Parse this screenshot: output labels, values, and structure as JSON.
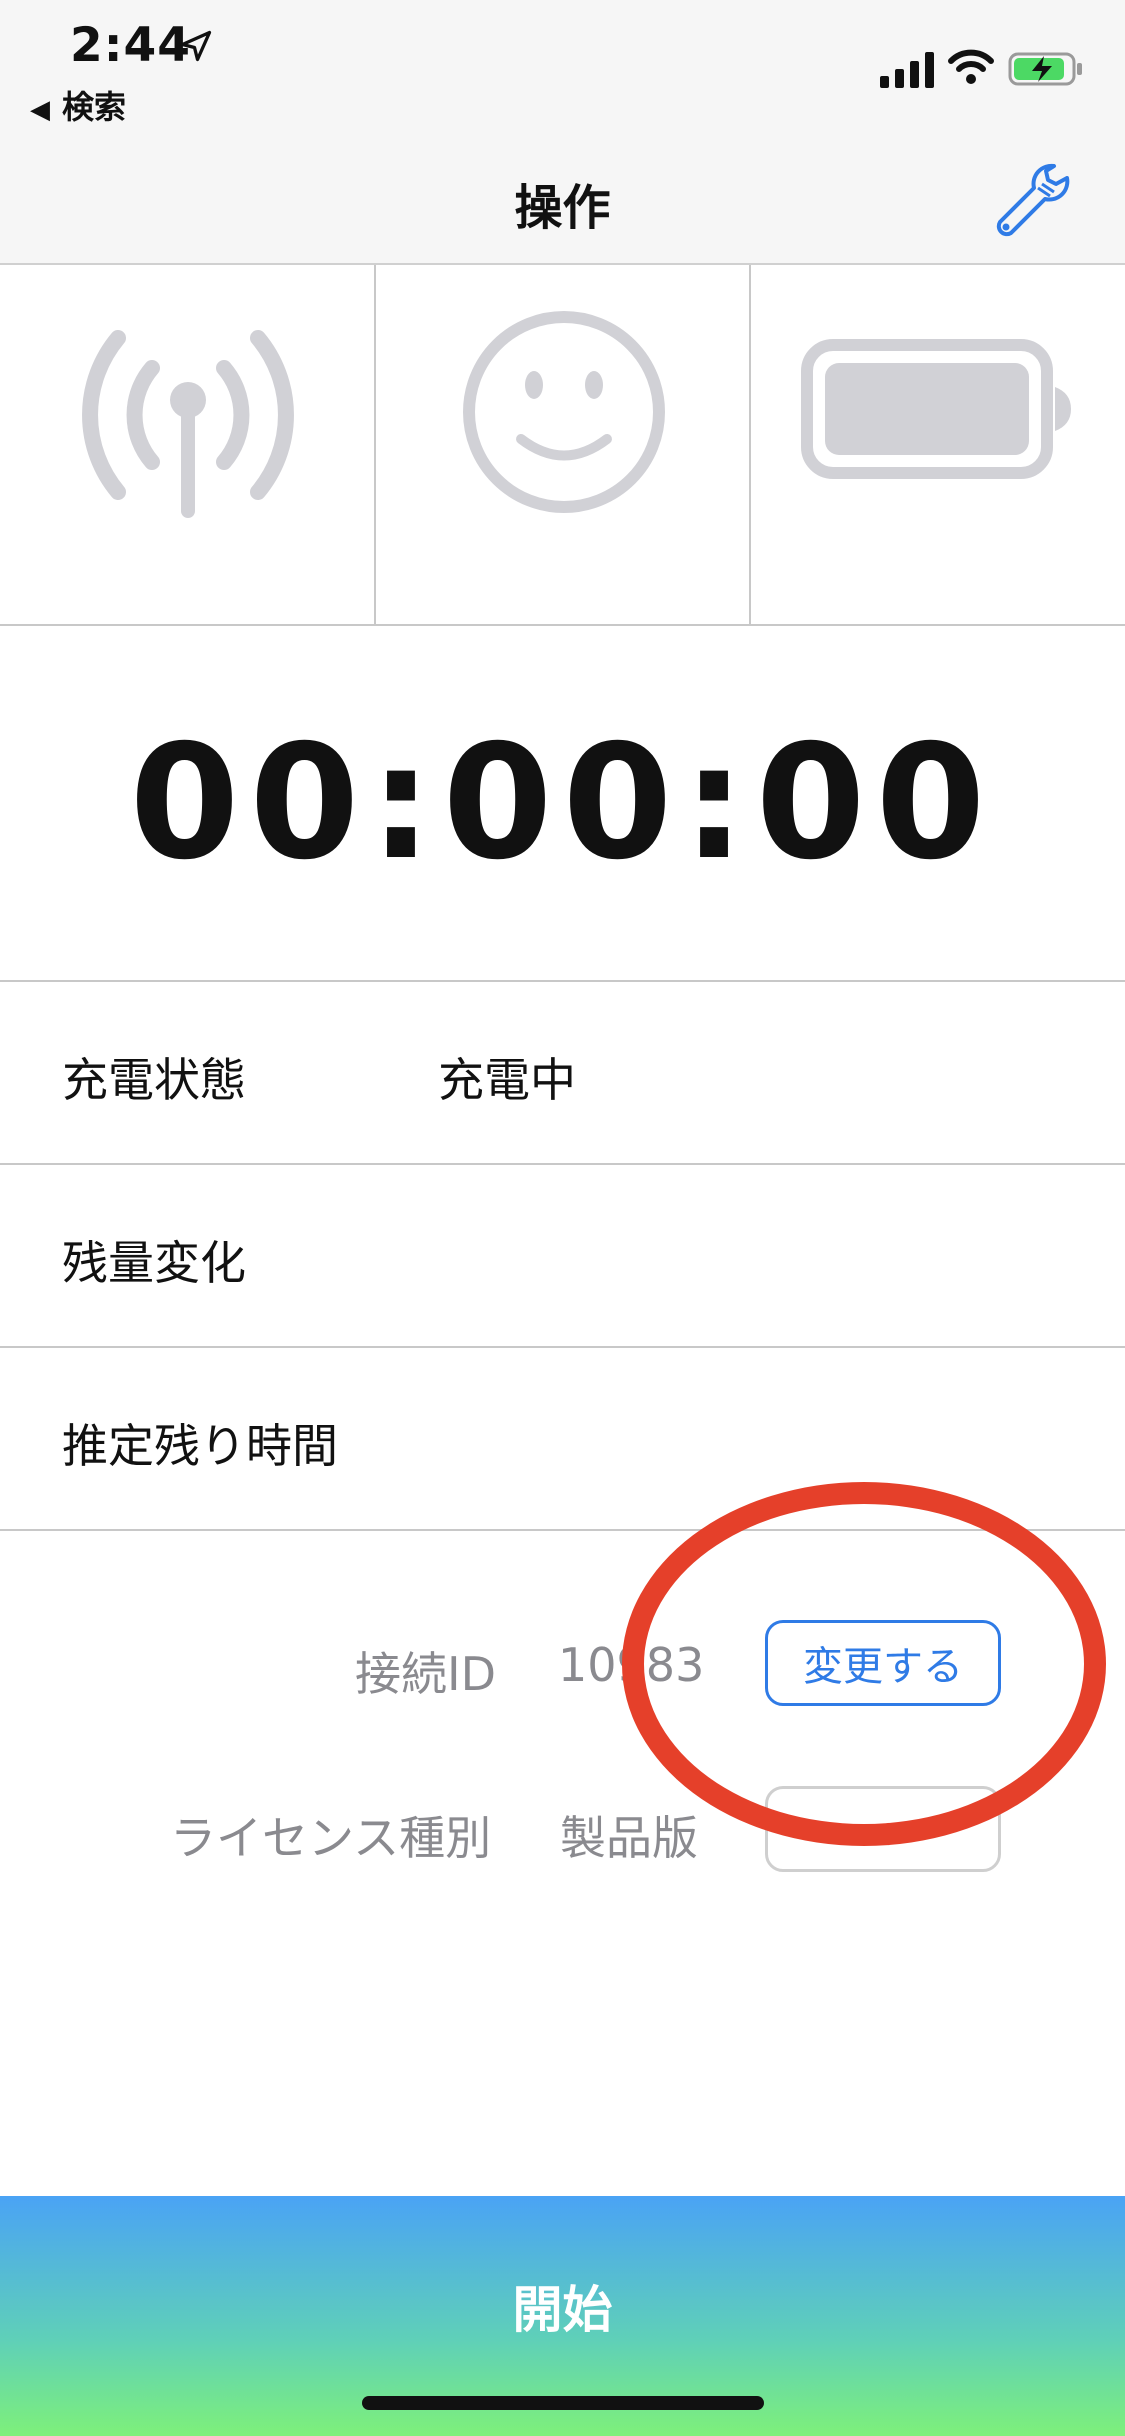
{
  "status_bar": {
    "time": "2:44",
    "back_label": "検索",
    "battery_color": "#4cd964"
  },
  "nav": {
    "title": "操作"
  },
  "indicators": [
    {
      "icon": "antenna-icon"
    },
    {
      "icon": "smiley-icon"
    },
    {
      "icon": "battery-icon"
    }
  ],
  "timer": {
    "display": "00:00:00"
  },
  "rows": [
    {
      "label": "充電状態",
      "value": "充電中"
    },
    {
      "label": "残量変化",
      "value": ""
    },
    {
      "label": "推定残り時間",
      "value": ""
    }
  ],
  "info": {
    "connection_id_label": "接続ID",
    "connection_id_value": "10983",
    "change_button": "変更する",
    "license_label": "ライセンス種別",
    "license_value": "製品版"
  },
  "start_button": "開始",
  "colors": {
    "accent": "#2f7be6",
    "annotation": "#e5402a",
    "icon_gray": "#d1d1d6"
  }
}
